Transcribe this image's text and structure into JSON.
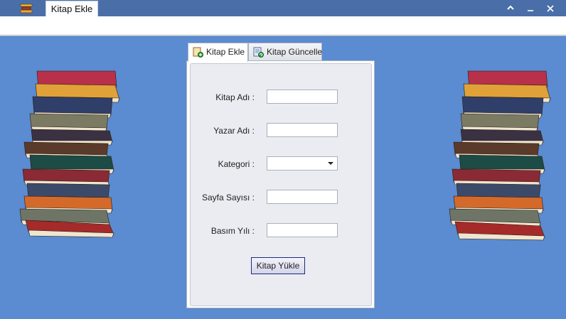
{
  "window": {
    "tab_title": "Kitap Ekle",
    "controls": {
      "restore": "⌃",
      "minimize": "–",
      "close": "✕"
    }
  },
  "tabs": [
    {
      "label": "Kitap Ekle",
      "icon": "add-document-icon",
      "active": true
    },
    {
      "label": "Kitap Güncelle",
      "icon": "update-document-icon",
      "active": false
    }
  ],
  "form": {
    "kitap_adi_label": "Kitap Adı :",
    "yazar_adi_label": "Yazar Adı :",
    "kategori_label": "Kategori :",
    "sayfa_sayisi_label": "Sayfa Sayısı :",
    "basim_yili_label": "Basım Yılı :",
    "kitap_adi_value": "",
    "yazar_adi_value": "",
    "kategori_value": "",
    "sayfa_sayisi_value": "",
    "basim_yili_value": "",
    "submit_label": "Kitap Yükle"
  },
  "colors": {
    "background": "#5b8bd0",
    "titlebar": "#4a6fa8",
    "panel": "#ebecf1",
    "button_border": "#1f2a7a"
  },
  "decor": {
    "left_image": "book-stack-icon",
    "right_image": "book-stack-icon"
  }
}
